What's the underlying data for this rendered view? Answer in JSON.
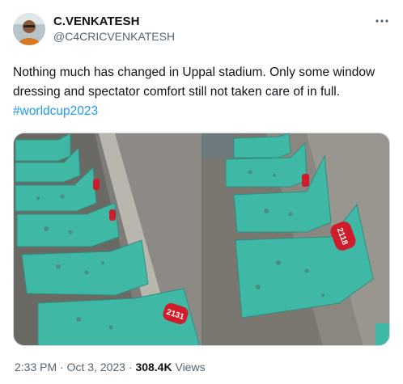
{
  "author": {
    "display_name": "C.VENKATESH",
    "handle": "@C4CRICVENKATESH"
  },
  "tweet": {
    "text": "Nothing much has changed in Uppal stadium. Only some window dressing and spectator comfort still not taken care of in full.",
    "hashtag": "#worldcup2023"
  },
  "photos": [
    {
      "seat_numbers": [
        "2131"
      ]
    },
    {
      "seat_numbers": [
        "2118"
      ]
    }
  ],
  "meta": {
    "time": "2:33 PM",
    "separator": "·",
    "date": "Oct 3, 2023",
    "views_count": "308.4K",
    "views_label": "Views"
  },
  "icons": {
    "more": "more-dots-icon"
  },
  "colors": {
    "link": "#1d9bf0",
    "secondary_text": "#536471",
    "seat": "#3fb8a6",
    "seat_label": "#d01c2a"
  }
}
